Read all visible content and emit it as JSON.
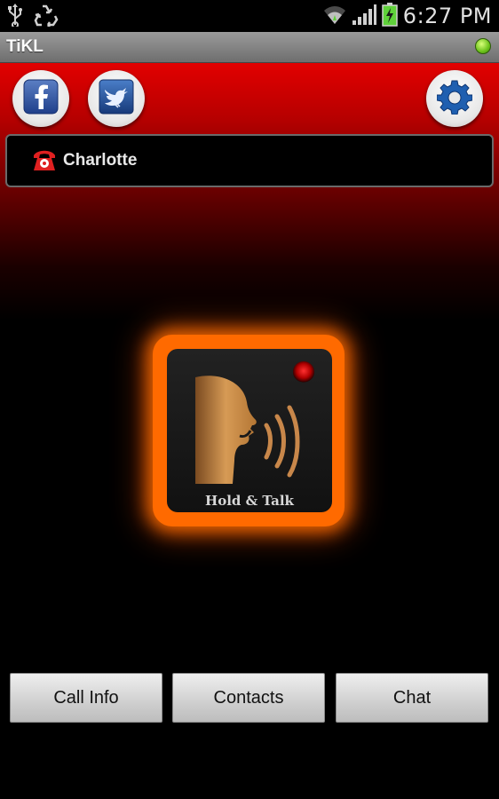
{
  "status_bar": {
    "time": "6:27 PM",
    "icons": [
      "usb-icon",
      "recycle-icon",
      "wifi-icon",
      "signal-icon",
      "battery-charging-icon"
    ]
  },
  "app": {
    "title": "TiKL",
    "status_color": "#6bc21a"
  },
  "toolbar": {
    "facebook_icon": "facebook-icon",
    "twitter_icon": "twitter-icon",
    "settings_icon": "gear-icon"
  },
  "contact": {
    "name": "Charlotte",
    "icon": "phone-icon"
  },
  "talk_button": {
    "label": "Hold & Talk",
    "glow_color": "#ff6a00"
  },
  "bottom_buttons": [
    {
      "label": "Call Info"
    },
    {
      "label": "Contacts"
    },
    {
      "label": "Chat"
    }
  ],
  "colors": {
    "brand_red": "#e20000",
    "accent_orange": "#ff6a00"
  }
}
